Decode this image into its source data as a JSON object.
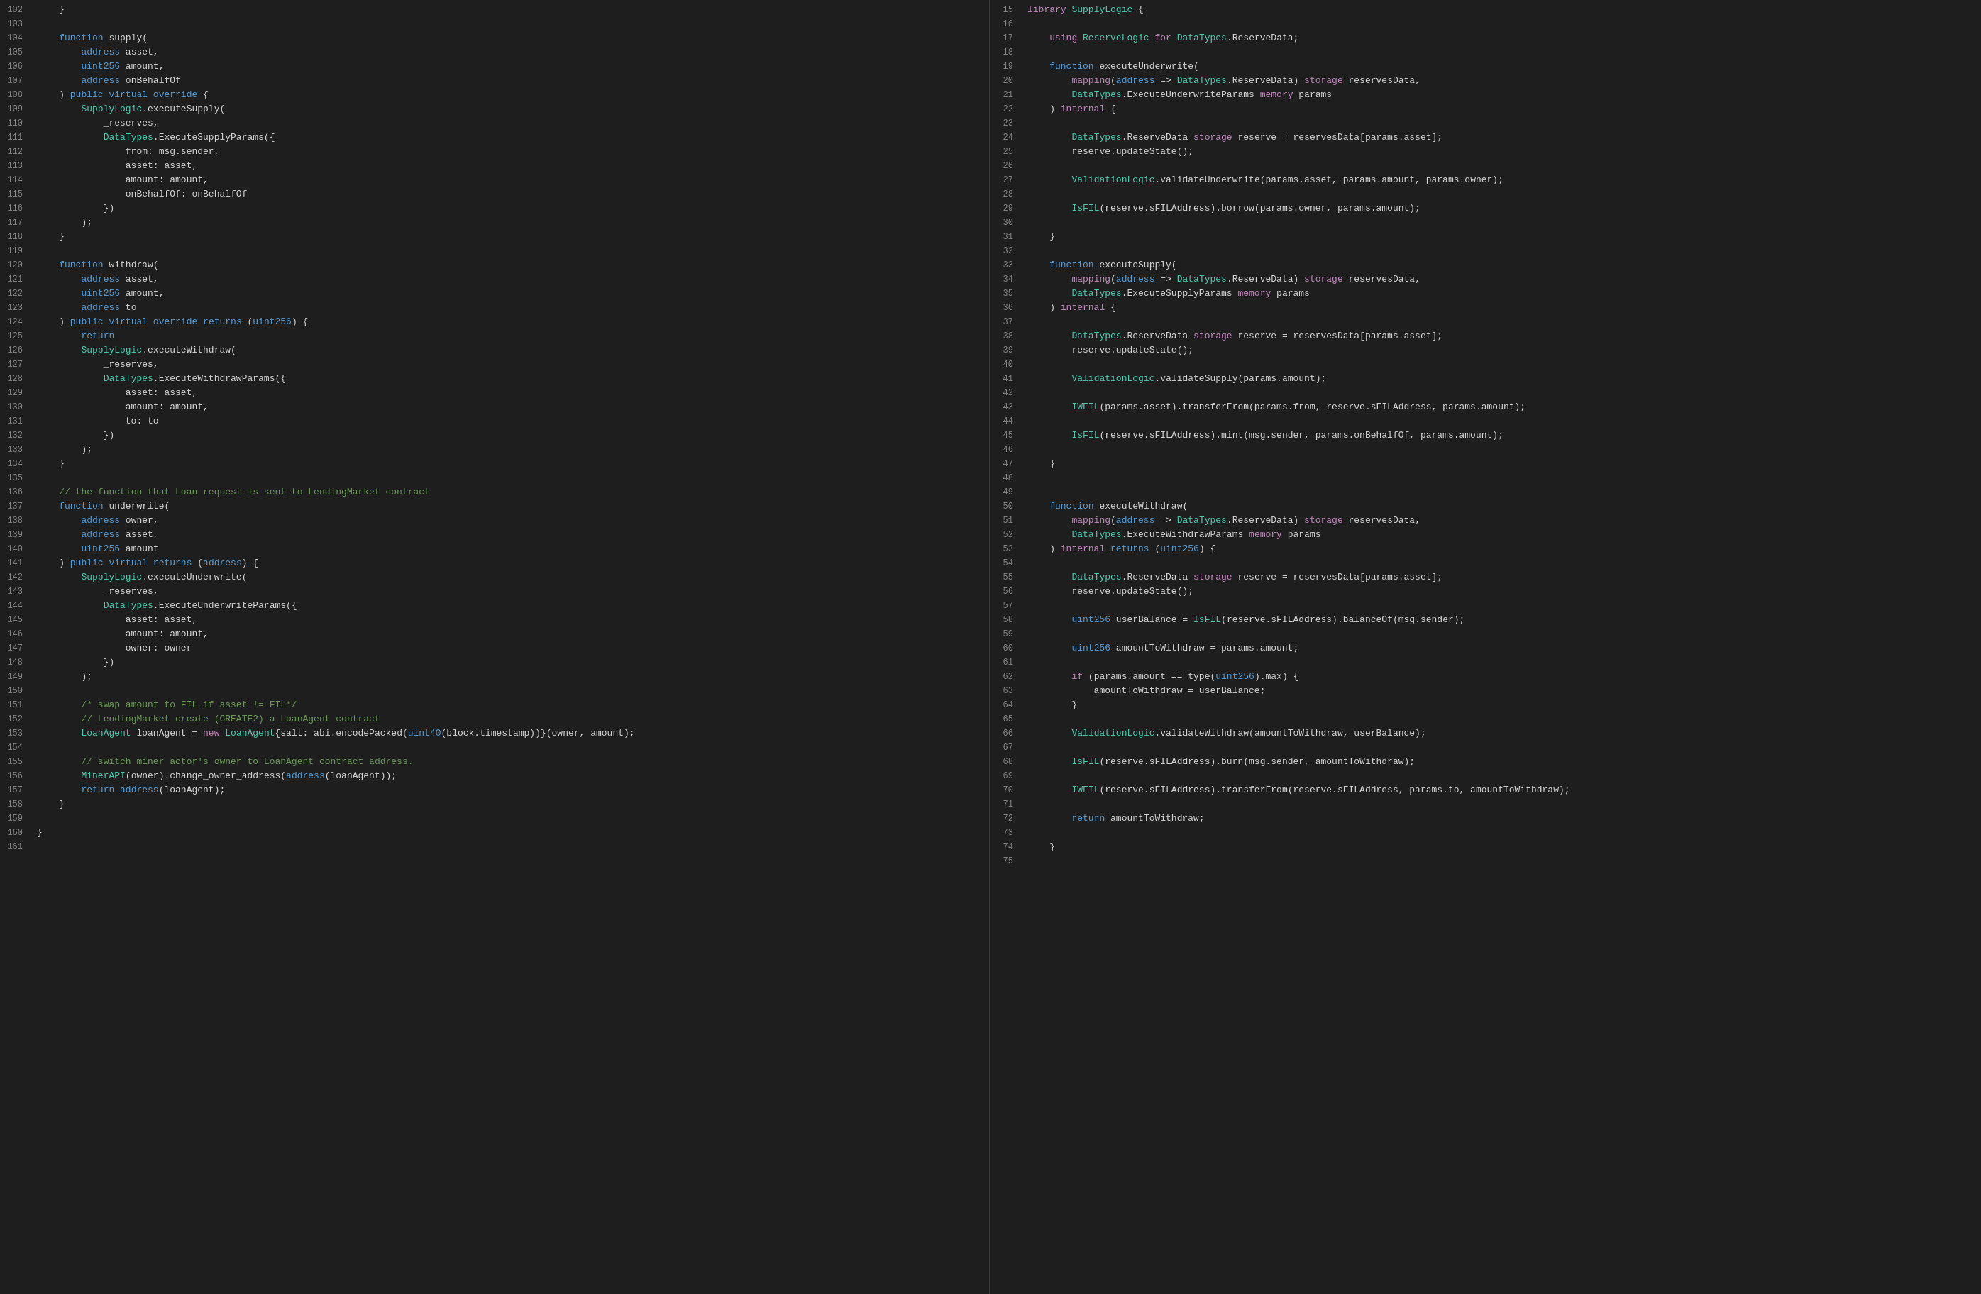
{
  "left_pane": {
    "lines": [
      {
        "num": 102,
        "content": "    }"
      },
      {
        "num": 103,
        "content": "",
        "bp": true
      },
      {
        "num": 104,
        "content": "    function supply(",
        "bp": true
      },
      {
        "num": 105,
        "content": "        address asset,"
      },
      {
        "num": 106,
        "content": "        uint256 amount,"
      },
      {
        "num": 107,
        "content": "        address onBehalfOf"
      },
      {
        "num": 108,
        "content": "    ) public virtual override {"
      },
      {
        "num": 109,
        "content": "        SupplyLogic.executeSupply("
      },
      {
        "num": 110,
        "content": "            _reserves,"
      },
      {
        "num": 111,
        "content": "            DataTypes.ExecuteSupplyParams({"
      },
      {
        "num": 112,
        "content": "                from: msg.sender,"
      },
      {
        "num": 113,
        "content": "                asset: asset,"
      },
      {
        "num": 114,
        "content": "                amount: amount,"
      },
      {
        "num": 115,
        "content": "                onBehalfOf: onBehalfOf"
      },
      {
        "num": 116,
        "content": "            })"
      },
      {
        "num": 117,
        "content": "        );"
      },
      {
        "num": 118,
        "content": "    }"
      },
      {
        "num": 119,
        "content": ""
      },
      {
        "num": 120,
        "content": "    function withdraw(",
        "bp": true
      },
      {
        "num": 121,
        "content": "        address asset,"
      },
      {
        "num": 122,
        "content": "        uint256 amount,"
      },
      {
        "num": 123,
        "content": "        address to"
      },
      {
        "num": 124,
        "content": "    ) public virtual override returns (uint256) {"
      },
      {
        "num": 125,
        "content": "        return"
      },
      {
        "num": 126,
        "content": "        SupplyLogic.executeWithdraw("
      },
      {
        "num": 127,
        "content": "            _reserves,"
      },
      {
        "num": 128,
        "content": "            DataTypes.ExecuteWithdrawParams({"
      },
      {
        "num": 129,
        "content": "                asset: asset,"
      },
      {
        "num": 130,
        "content": "                amount: amount,"
      },
      {
        "num": 131,
        "content": "                to: to"
      },
      {
        "num": 132,
        "content": "            })"
      },
      {
        "num": 133,
        "content": "        );"
      },
      {
        "num": 134,
        "content": "    }"
      },
      {
        "num": 135,
        "content": ""
      },
      {
        "num": 136,
        "content": "    // the function that Loan request is sent to LendingMarket contract"
      },
      {
        "num": 137,
        "content": "    function underwrite("
      },
      {
        "num": 138,
        "content": "        address owner,"
      },
      {
        "num": 139,
        "content": "        address asset,"
      },
      {
        "num": 140,
        "content": "        uint256 amount"
      },
      {
        "num": 141,
        "content": "    ) public virtual returns (address) {"
      },
      {
        "num": 142,
        "content": "        SupplyLogic.executeUnderwrite("
      },
      {
        "num": 143,
        "content": "            _reserves,"
      },
      {
        "num": 144,
        "content": "            DataTypes.ExecuteUnderwriteParams({"
      },
      {
        "num": 145,
        "content": "                asset: asset,"
      },
      {
        "num": 146,
        "content": "                amount: amount,"
      },
      {
        "num": 147,
        "content": "                owner: owner"
      },
      {
        "num": 148,
        "content": "            })"
      },
      {
        "num": 149,
        "content": "        );"
      },
      {
        "num": 150,
        "content": ""
      },
      {
        "num": 151,
        "content": "        /* swap amount to FIL if asset != FIL*/"
      },
      {
        "num": 152,
        "content": "        // LendingMarket create (CREATE2) a LoanAgent contract"
      },
      {
        "num": 153,
        "content": "        LoanAgent loanAgent = new LoanAgent{salt: abi.encodePacked(uint40(block.timestamp))}(owner, amount);"
      },
      {
        "num": 154,
        "content": ""
      },
      {
        "num": 155,
        "content": "        // switch miner actor's owner to LoanAgent contract address."
      },
      {
        "num": 156,
        "content": "        MinerAPI(owner).change_owner_address(address(loanAgent));"
      },
      {
        "num": 157,
        "content": "        return address(loanAgent);"
      },
      {
        "num": 158,
        "content": "    }"
      },
      {
        "num": 159,
        "content": ""
      },
      {
        "num": 160,
        "content": "}"
      },
      {
        "num": 161,
        "content": ""
      }
    ]
  },
  "right_pane": {
    "lines": [
      {
        "num": 15,
        "content": "library SupplyLogic {"
      },
      {
        "num": 16,
        "content": ""
      },
      {
        "num": 17,
        "content": "    using ReserveLogic for DataTypes.ReserveData;"
      },
      {
        "num": 18,
        "content": "",
        "bp": true
      },
      {
        "num": 19,
        "content": "    function executeUnderwrite("
      },
      {
        "num": 20,
        "content": "        mapping(address => DataTypes.ReserveData) storage reservesData,"
      },
      {
        "num": 21,
        "content": "        DataTypes.ExecuteUnderwriteParams memory params"
      },
      {
        "num": 22,
        "content": "    ) internal {"
      },
      {
        "num": 23,
        "content": ""
      },
      {
        "num": 24,
        "content": "        DataTypes.ReserveData storage reserve = reservesData[params.asset];"
      },
      {
        "num": 25,
        "content": "        reserve.updateState();"
      },
      {
        "num": 26,
        "content": ""
      },
      {
        "num": 27,
        "content": "        ValidationLogic.validateUnderwrite(params.asset, params.amount, params.owner);"
      },
      {
        "num": 28,
        "content": ""
      },
      {
        "num": 29,
        "content": "        IsFIL(reserve.sFILAddress).borrow(params.owner, params.amount);"
      },
      {
        "num": 30,
        "content": ""
      },
      {
        "num": 31,
        "content": "    }"
      },
      {
        "num": 32,
        "content": "",
        "bp": true
      },
      {
        "num": 33,
        "content": "    function executeSupply("
      },
      {
        "num": 34,
        "content": "        mapping(address => DataTypes.ReserveData) storage reservesData,"
      },
      {
        "num": 35,
        "content": "        DataTypes.ExecuteSupplyParams memory params"
      },
      {
        "num": 36,
        "content": "    ) internal {"
      },
      {
        "num": 37,
        "content": ""
      },
      {
        "num": 38,
        "content": "        DataTypes.ReserveData storage reserve = reservesData[params.asset];"
      },
      {
        "num": 39,
        "content": "        reserve.updateState();"
      },
      {
        "num": 40,
        "content": ""
      },
      {
        "num": 41,
        "content": "        ValidationLogic.validateSupply(params.amount);"
      },
      {
        "num": 42,
        "content": ""
      },
      {
        "num": 43,
        "content": "        IWFIL(params.asset).transferFrom(params.from, reserve.sFILAddress, params.amount);"
      },
      {
        "num": 44,
        "content": ""
      },
      {
        "num": 45,
        "content": "        IsFIL(reserve.sFILAddress).mint(msg.sender, params.onBehalfOf, params.amount);"
      },
      {
        "num": 46,
        "content": ""
      },
      {
        "num": 47,
        "content": "    }"
      },
      {
        "num": 48,
        "content": ""
      },
      {
        "num": 49,
        "content": "",
        "bp": true
      },
      {
        "num": 50,
        "content": "    function executeWithdraw("
      },
      {
        "num": 51,
        "content": "        mapping(address => DataTypes.ReserveData) storage reservesData,"
      },
      {
        "num": 52,
        "content": "        DataTypes.ExecuteWithdrawParams memory params"
      },
      {
        "num": 53,
        "content": "    ) internal returns (uint256) {"
      },
      {
        "num": 54,
        "content": ""
      },
      {
        "num": 55,
        "content": "        DataTypes.ReserveData storage reserve = reservesData[params.asset];"
      },
      {
        "num": 56,
        "content": "        reserve.updateState();"
      },
      {
        "num": 57,
        "content": ""
      },
      {
        "num": 58,
        "content": "        uint256 userBalance = IsFIL(reserve.sFILAddress).balanceOf(msg.sender);"
      },
      {
        "num": 59,
        "content": ""
      },
      {
        "num": 60,
        "content": "        uint256 amountToWithdraw = params.amount;"
      },
      {
        "num": 61,
        "content": ""
      },
      {
        "num": 62,
        "content": "        if (params.amount == type(uint256).max) {"
      },
      {
        "num": 63,
        "content": "            amountToWithdraw = userBalance;"
      },
      {
        "num": 64,
        "content": "        }"
      },
      {
        "num": 65,
        "content": ""
      },
      {
        "num": 66,
        "content": "        ValidationLogic.validateWithdraw(amountToWithdraw, userBalance);"
      },
      {
        "num": 67,
        "content": ""
      },
      {
        "num": 68,
        "content": "        IsFIL(reserve.sFILAddress).burn(msg.sender, amountToWithdraw);"
      },
      {
        "num": 69,
        "content": ""
      },
      {
        "num": 70,
        "content": "        IWFIL(reserve.sFILAddress).transferFrom(reserve.sFILAddress, params.to, amountToWithdraw);"
      },
      {
        "num": 71,
        "content": ""
      },
      {
        "num": 72,
        "content": "        return amountToWithdraw;"
      },
      {
        "num": 73,
        "content": ""
      },
      {
        "num": 74,
        "content": "    }"
      },
      {
        "num": 75,
        "content": ""
      }
    ]
  }
}
